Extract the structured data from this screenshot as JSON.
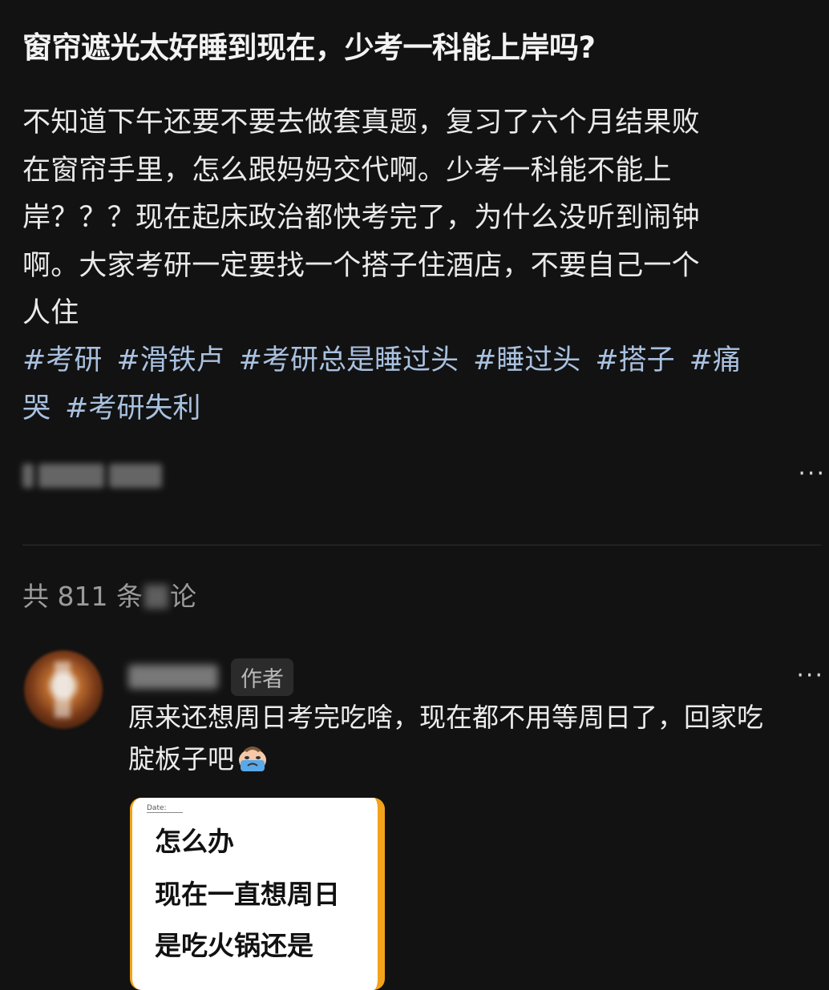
{
  "post": {
    "title": "窗帘遮光太好睡到现在，少考一科能上岸吗?",
    "body_lines": [
      "不知道下午还要不要去做套真题，复习了六个月结果败",
      "在窗帘手里，怎么跟妈妈交代啊。少考一科能不能上",
      "岸？？？现在起床政治都快考完了，为什么没听到闹钟",
      "啊。大家考研一定要找一个搭子住酒店，不要自己一个",
      "人住"
    ],
    "tags_line1": [
      "#考研",
      "#滑铁卢",
      "#考研总是睡过头",
      "#睡过头",
      "#搭子",
      "#痛"
    ],
    "tags_line2": [
      "哭",
      "#考研失利"
    ],
    "more_label": "···"
  },
  "comments_section": {
    "count_prefix": "共 811 条",
    "count_suffix": "论"
  },
  "comment": {
    "author_badge": "作者",
    "more_label": "···",
    "text_lines": [
      "原来还想周日考完吃啥，现在都不用等周日了，回家吃",
      "腚板子吧"
    ],
    "emoji_icon": "crying-face-icon",
    "image_note": {
      "date_label": "Date:",
      "lines": [
        "怎么办",
        "现在一直想周日",
        "是吃火锅还是"
      ]
    }
  },
  "colors": {
    "background": "#121212",
    "tag": "#a9c1e0",
    "accent_border": "#f2a21b"
  }
}
